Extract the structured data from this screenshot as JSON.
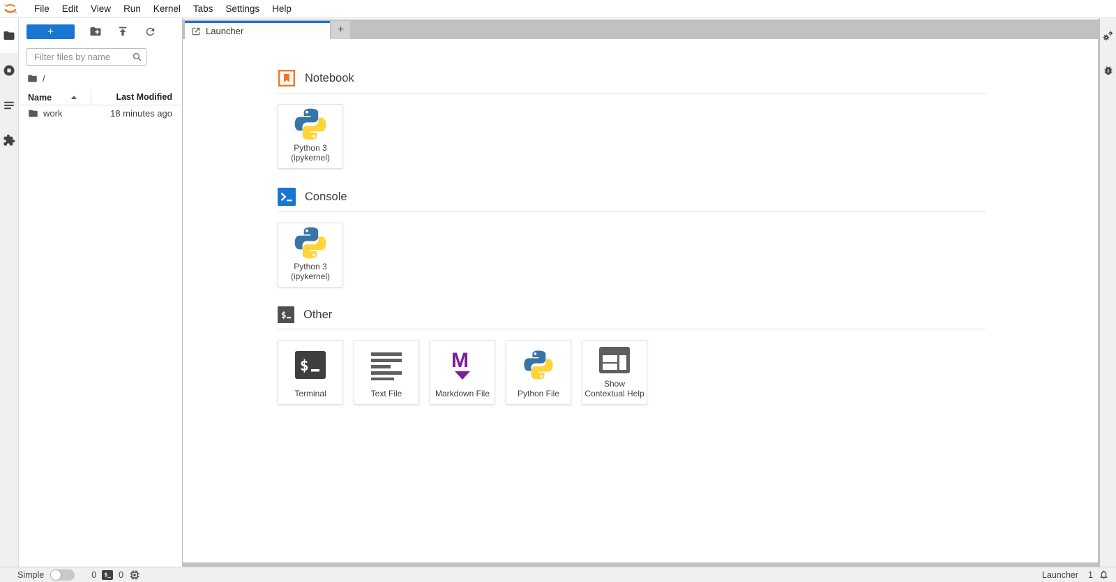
{
  "menu": {
    "items": [
      "File",
      "Edit",
      "View",
      "Run",
      "Kernel",
      "Tabs",
      "Settings",
      "Help"
    ]
  },
  "file_browser": {
    "new_launcher_label": "+",
    "filter_placeholder": "Filter files by name",
    "breadcrumb_root": "/",
    "columns": {
      "name": "Name",
      "modified": "Last Modified"
    },
    "rows": [
      {
        "name": "work",
        "modified": "18 minutes ago"
      }
    ]
  },
  "tab_bar": {
    "tabs": [
      {
        "label": "Launcher"
      }
    ],
    "new_tab_label": "+"
  },
  "launcher": {
    "sections": [
      {
        "title": "Notebook",
        "cards": [
          {
            "label": "Python 3\n(ipykernel)"
          }
        ]
      },
      {
        "title": "Console",
        "cards": [
          {
            "label": "Python 3\n(ipykernel)"
          }
        ]
      },
      {
        "title": "Other",
        "cards": [
          {
            "label": "Terminal"
          },
          {
            "label": "Text File"
          },
          {
            "label": "Markdown File"
          },
          {
            "label": "Python File"
          },
          {
            "label": "Show\nContextual Help"
          }
        ]
      }
    ]
  },
  "status_bar": {
    "mode_label": "Simple",
    "terminals_count": "0",
    "kernels_count": "0",
    "terminal_glyph": "$_",
    "context": "Launcher",
    "notifications_count": "1"
  },
  "colors": {
    "brand_blue": "#1976d2",
    "jupyter_orange": "#F37626",
    "markdown_purple": "#7B1FA2",
    "python_blue": "#3775A9",
    "python_yellow": "#FFD43B",
    "tabbar_gray": "#c1c1c1"
  }
}
